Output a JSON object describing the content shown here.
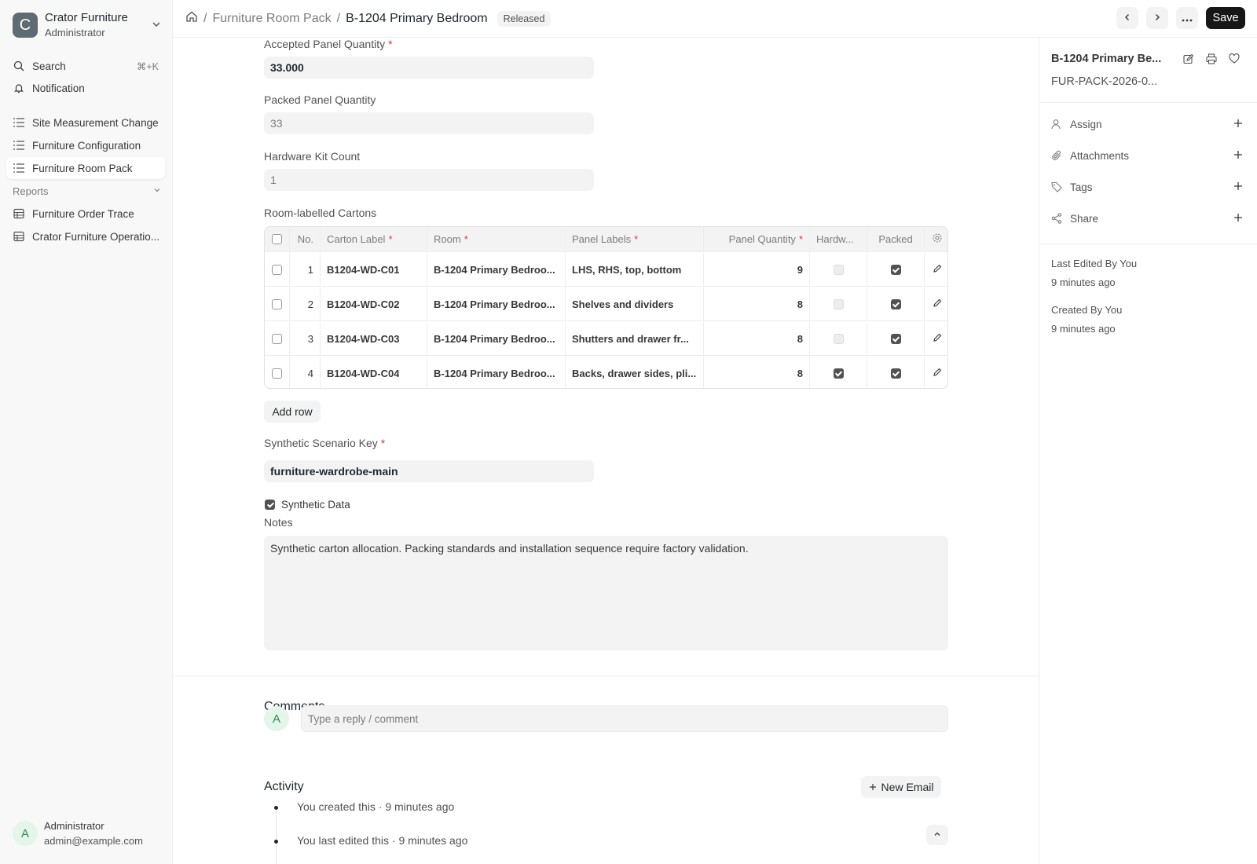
{
  "workspace": {
    "initial": "C",
    "name": "Crator Furniture",
    "role": "Administrator"
  },
  "sidebar": {
    "search_label": "Search",
    "search_shortcut": "⌘+K",
    "notification_label": "Notification",
    "items": [
      {
        "label": "Site Measurement Change"
      },
      {
        "label": "Furniture Configuration"
      },
      {
        "label": "Furniture Room Pack",
        "active": true
      }
    ],
    "reports_label": "Reports",
    "reports": [
      {
        "label": "Furniture Order Trace"
      },
      {
        "label": "Crator Furniture Operatio..."
      }
    ],
    "user": {
      "initial": "A",
      "name": "Administrator",
      "email": "admin@example.com"
    }
  },
  "topbar": {
    "breadcrumb_doctype": "Furniture Room Pack",
    "breadcrumb_current": "B-1204 Primary Bedroom",
    "status_badge": "Released",
    "save_label": "Save"
  },
  "form": {
    "accepted_qty": {
      "label": "Accepted Panel Quantity",
      "value": "33.000"
    },
    "packed_qty": {
      "label": "Packed Panel Quantity",
      "value": "33"
    },
    "hardware_kit": {
      "label": "Hardware Kit Count",
      "value": "1"
    },
    "cartons_label": "Room-labelled Cartons",
    "table": {
      "headers": {
        "no": "No.",
        "carton": "Carton Label",
        "room": "Room",
        "panels": "Panel Labels",
        "qty": "Panel Quantity",
        "hardware": "Hardw...",
        "packed": "Packed"
      },
      "rows": [
        {
          "no": "1",
          "carton": "B1204-WD-C01",
          "room": "B-1204 Primary Bedroo...",
          "panels": "LHS, RHS, top, bottom",
          "qty": "9",
          "hardware": false,
          "packed": true
        },
        {
          "no": "2",
          "carton": "B1204-WD-C02",
          "room": "B-1204 Primary Bedroo...",
          "panels": "Shelves and dividers",
          "qty": "8",
          "hardware": false,
          "packed": true
        },
        {
          "no": "3",
          "carton": "B1204-WD-C03",
          "room": "B-1204 Primary Bedroo...",
          "panels": "Shutters and drawer fr...",
          "qty": "8",
          "hardware": false,
          "packed": true
        },
        {
          "no": "4",
          "carton": "B1204-WD-C04",
          "room": "B-1204 Primary Bedroo...",
          "panels": "Backs, drawer sides, pli...",
          "qty": "8",
          "hardware": true,
          "packed": true
        }
      ]
    },
    "add_row_label": "Add row",
    "scenario_key": {
      "label": "Synthetic Scenario Key",
      "value": "furniture-wardrobe-main"
    },
    "synthetic_data": {
      "label": "Synthetic Data",
      "checked": true
    },
    "notes": {
      "label": "Notes",
      "value": "Synthetic carton allocation. Packing standards and installation sequence require factory validation."
    }
  },
  "comments": {
    "title": "Comments",
    "avatar_initial": "A",
    "placeholder": "Type a reply / comment"
  },
  "activity": {
    "title": "Activity",
    "new_email_label": "New Email",
    "items": [
      {
        "text": "You created this · 9 minutes ago"
      },
      {
        "text": "You last edited this · 9 minutes ago"
      }
    ]
  },
  "right_panel": {
    "title": "B-1204 Primary Be...",
    "doc_id": "FUR-PACK-2026-0...",
    "actions": [
      {
        "label": "Assign",
        "icon": "user-icon"
      },
      {
        "label": "Attachments",
        "icon": "paperclip-icon"
      },
      {
        "label": "Tags",
        "icon": "tag-icon"
      },
      {
        "label": "Share",
        "icon": "share-icon"
      }
    ],
    "last_edited_label": "Last Edited By You",
    "last_edited_time": "9 minutes ago",
    "created_label": "Created By You",
    "created_time": "9 minutes ago"
  },
  "colors": {
    "accent": "#171717",
    "required": "#e03636",
    "field_bg": "#f3f3f3",
    "sidebar_bg": "#f8f8f8"
  }
}
